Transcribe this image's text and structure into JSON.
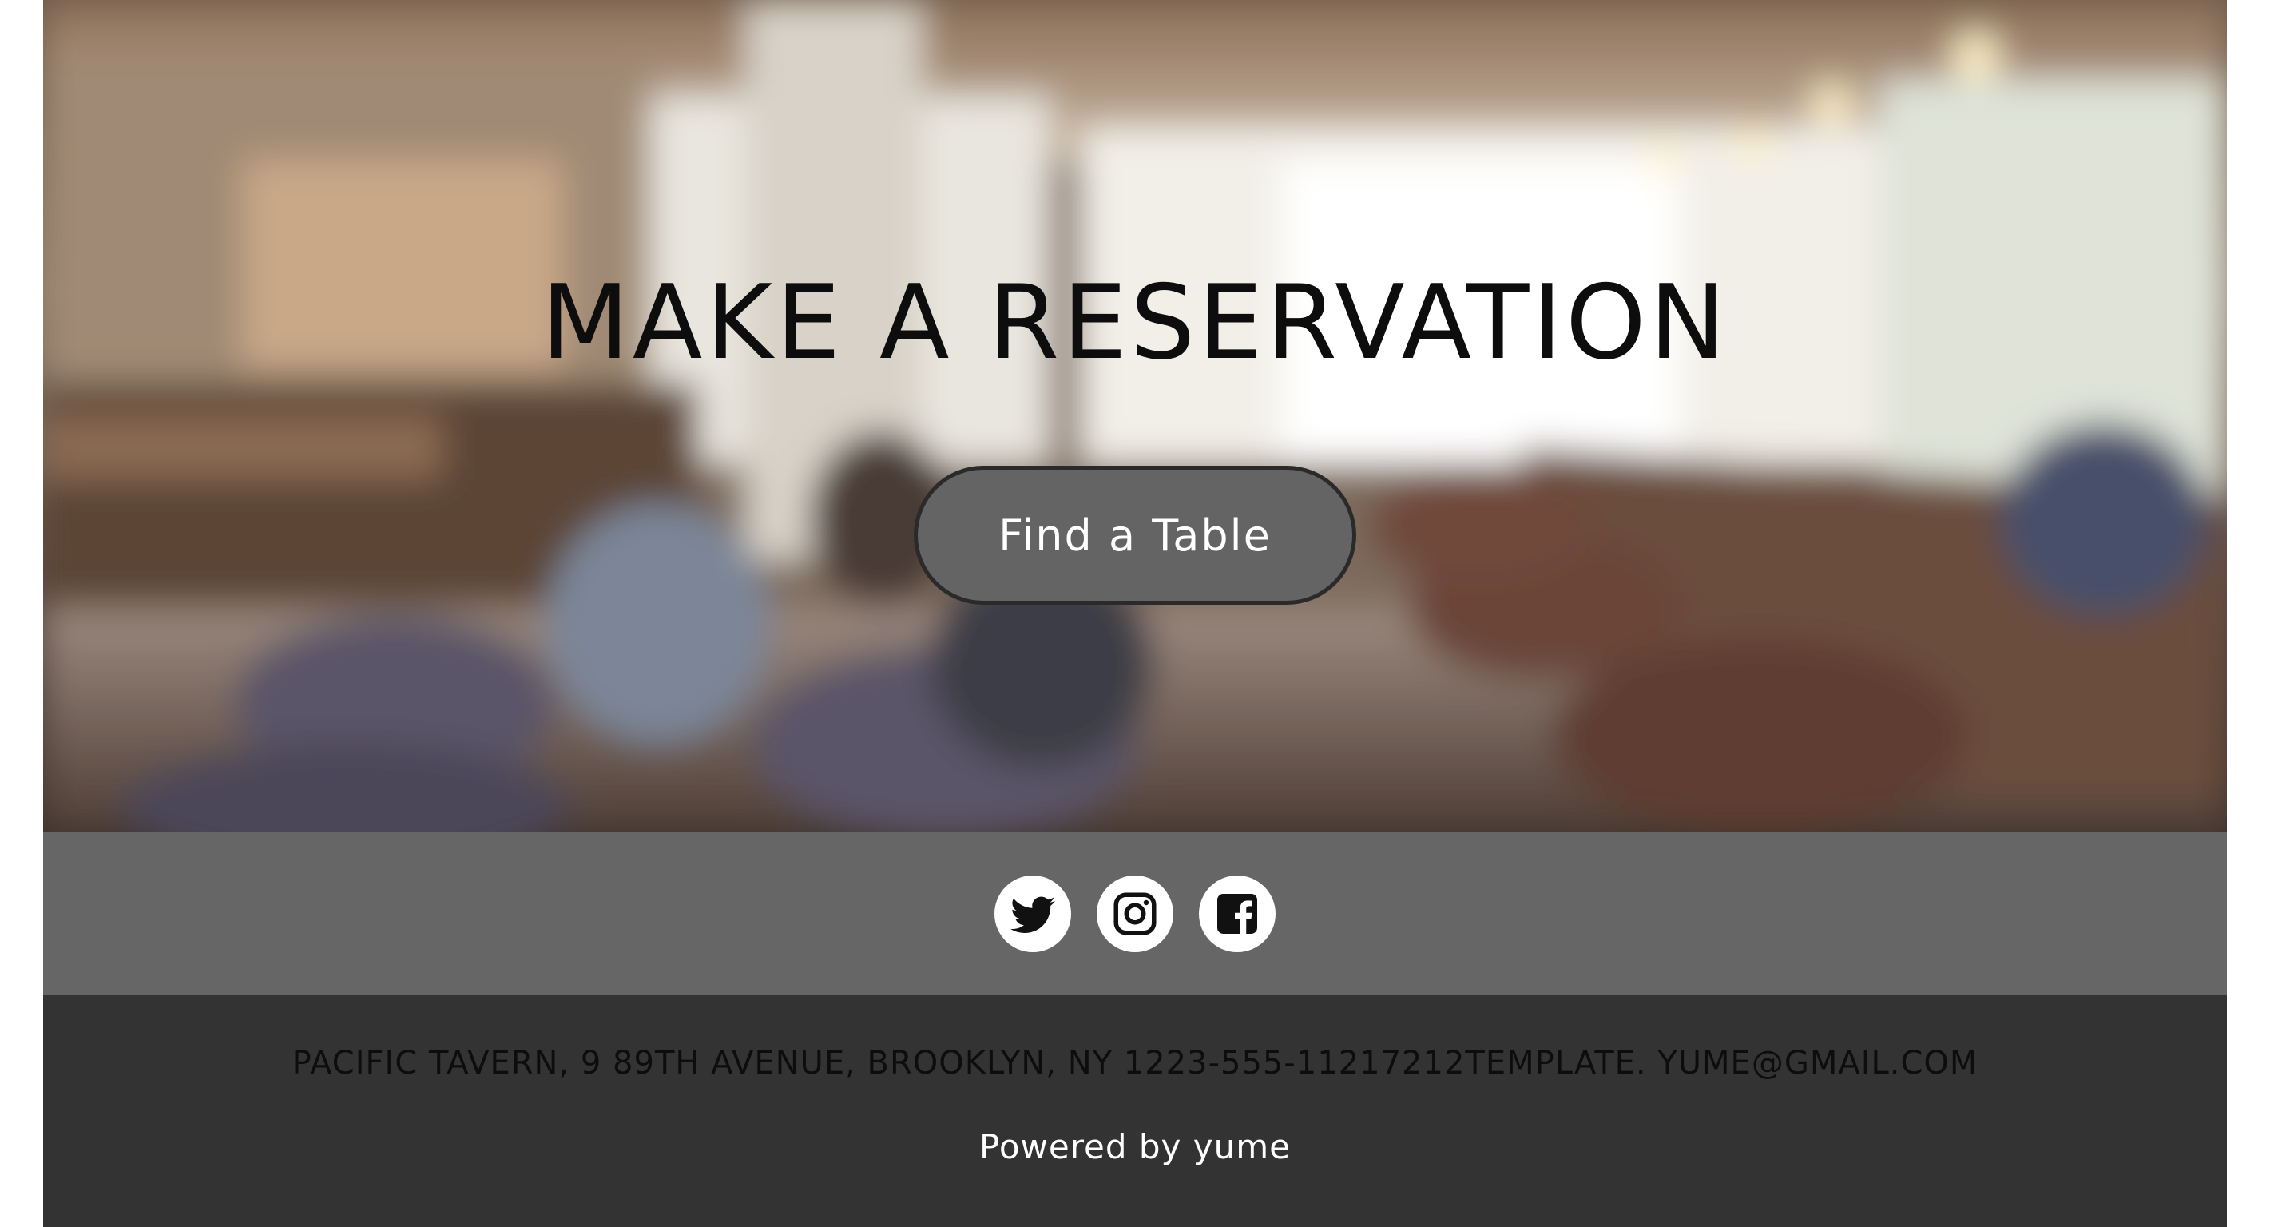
{
  "hero": {
    "title": "MAKE A RESERVATION",
    "button_label": "Find a Table",
    "background": "blurred-restaurant-interior-photo"
  },
  "social": {
    "items": [
      {
        "name": "twitter",
        "icon": "twitter-icon"
      },
      {
        "name": "instagram",
        "icon": "instagram-icon"
      },
      {
        "name": "facebook",
        "icon": "facebook-icon"
      }
    ]
  },
  "footer": {
    "address": "PACIFIC TAVERN, 9 89TH AVENUE, BROOKLYN, NY 1223-555-11217212TEMPLATE. YUME@GMAIL.COM",
    "powered_by": "Powered by yume"
  },
  "colors": {
    "social_bar": "#666666",
    "footer": "#333333",
    "button": "#646464",
    "button_border": "#2a2a2a"
  }
}
